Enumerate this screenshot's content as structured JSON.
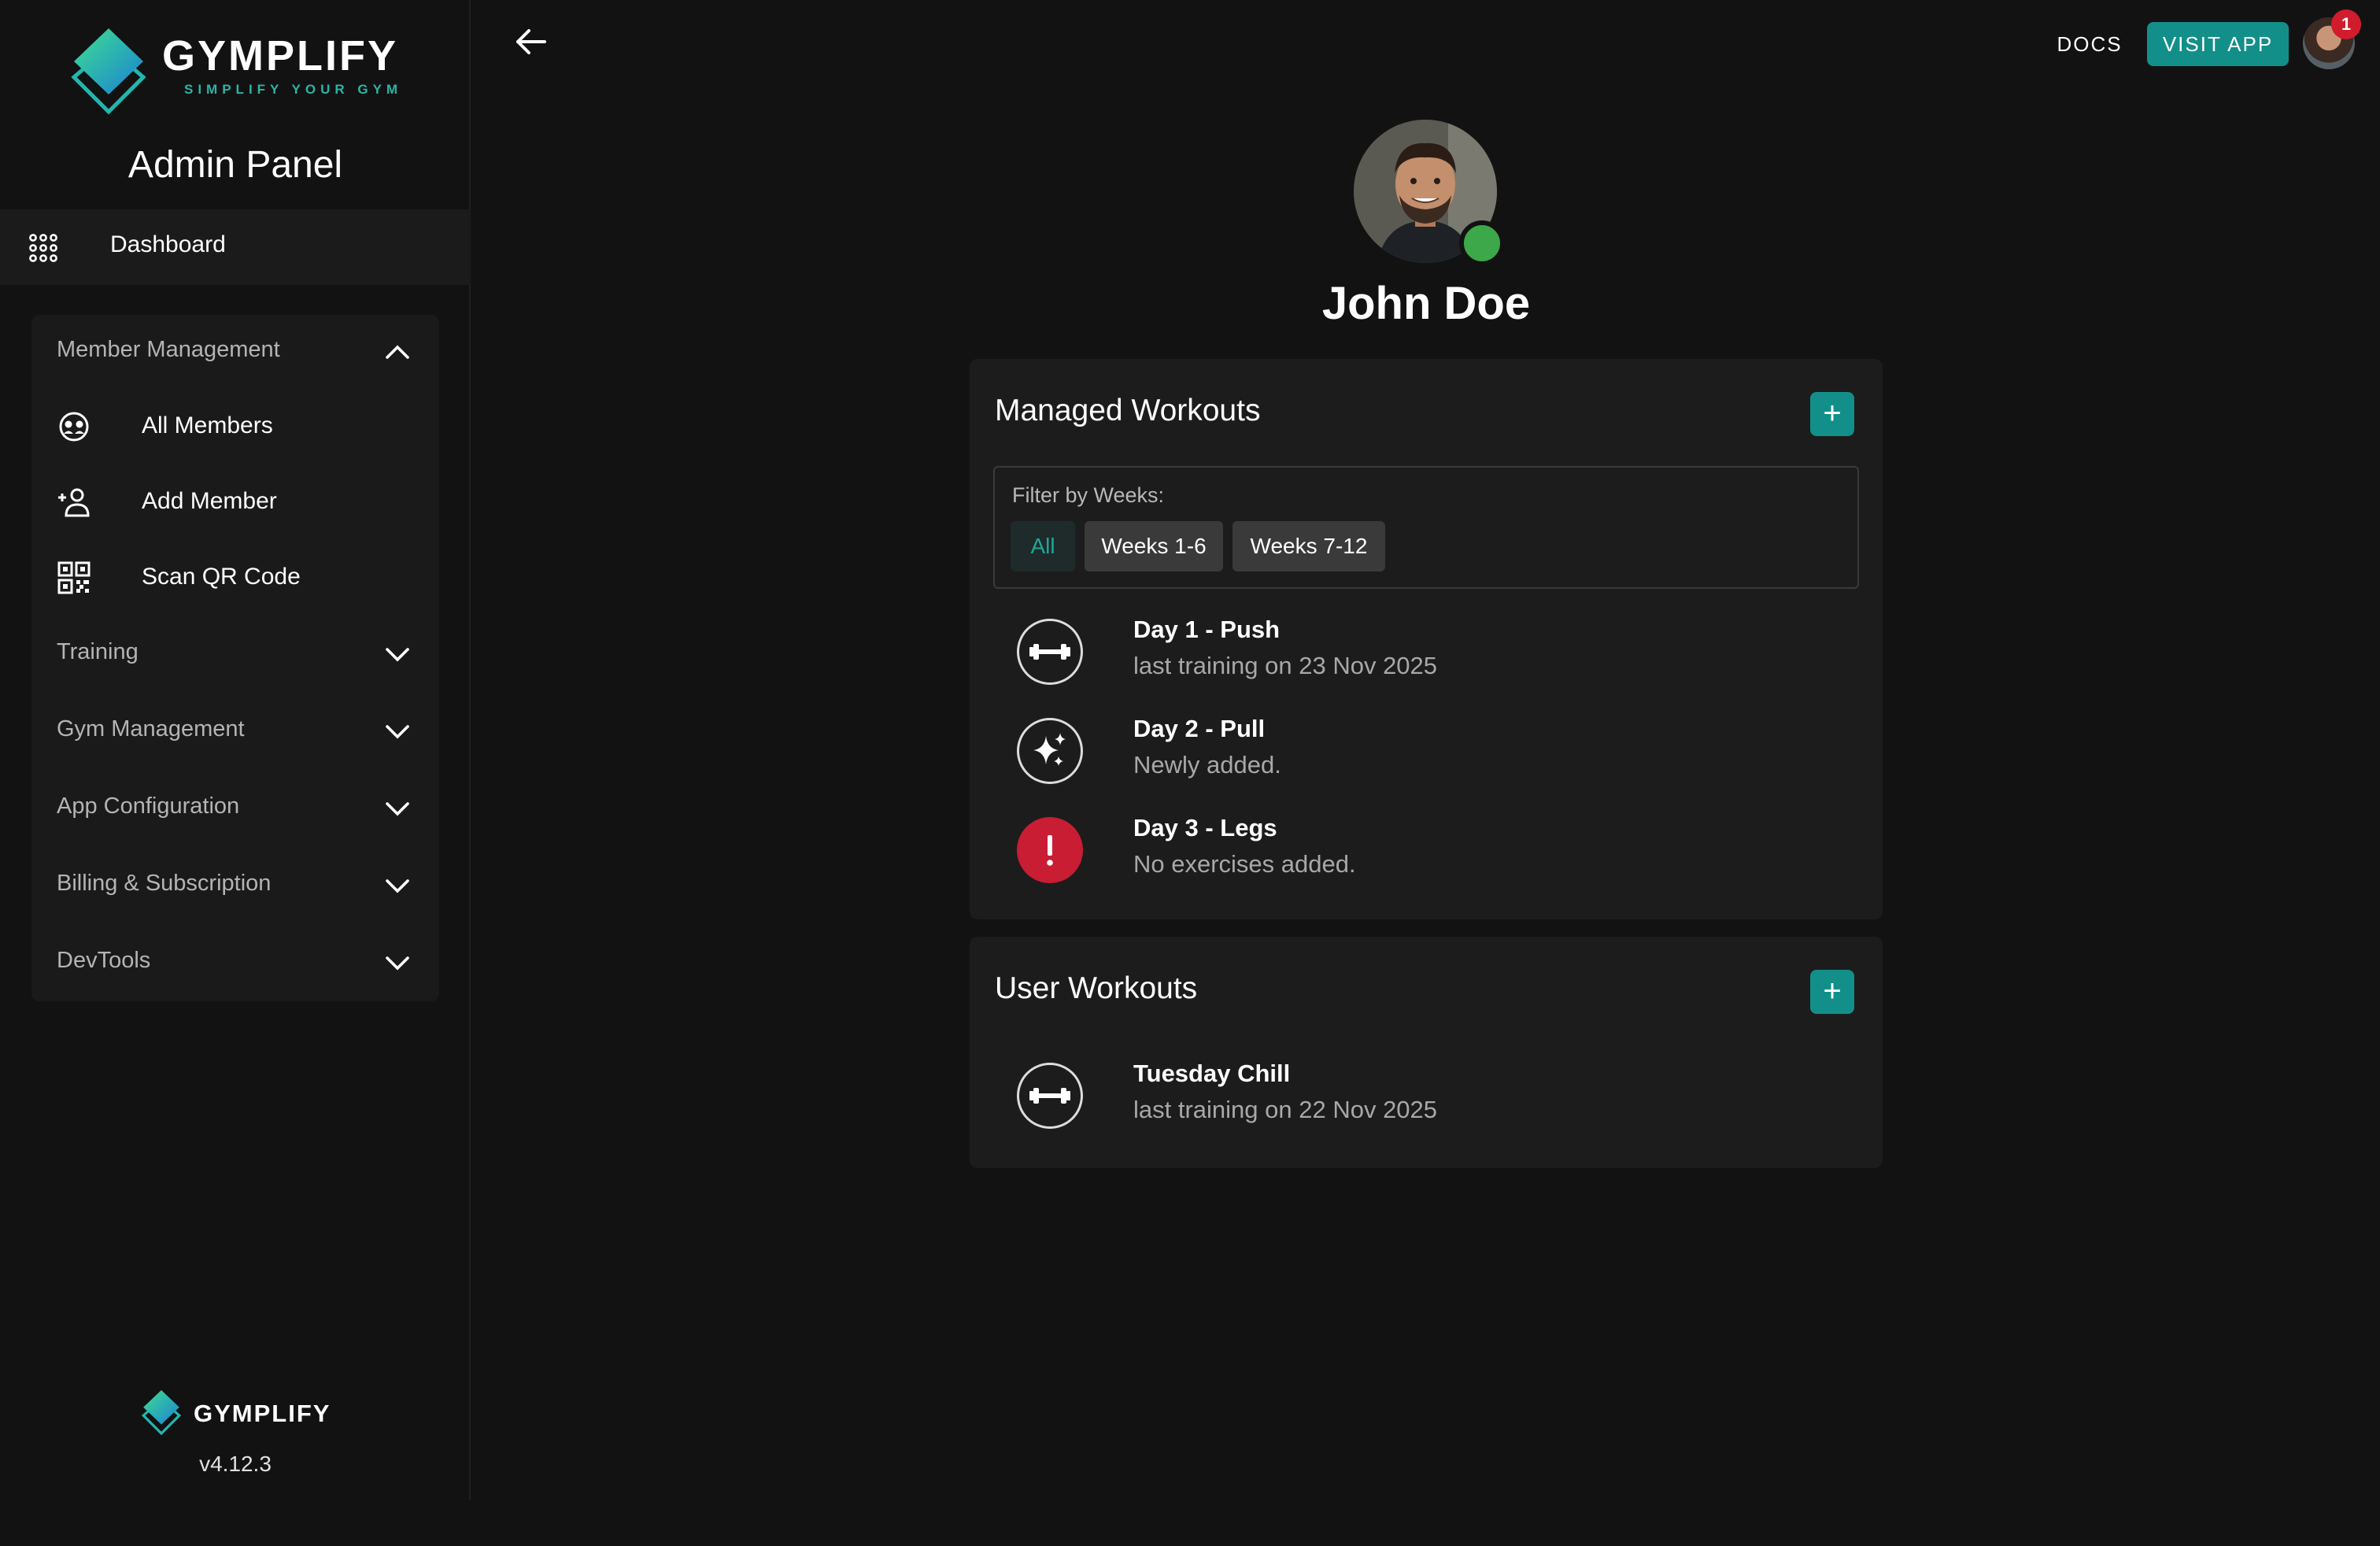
{
  "brand": {
    "name": "GYMPLIFY",
    "tagline": "SIMPLIFY YOUR GYM",
    "panel_title": "Admin Panel",
    "version": "v4.12.3",
    "accent": "#138f8a"
  },
  "sidebar": {
    "dashboard_label": "Dashboard",
    "sections": [
      {
        "label": "Member Management",
        "expanded": true,
        "items": [
          {
            "label": "All Members",
            "icon": "members-icon"
          },
          {
            "label": "Add Member",
            "icon": "add-person-icon"
          },
          {
            "label": "Scan QR Code",
            "icon": "qr-code-icon"
          }
        ]
      },
      {
        "label": "Training",
        "expanded": false
      },
      {
        "label": "Gym Management",
        "expanded": false
      },
      {
        "label": "App Configuration",
        "expanded": false
      },
      {
        "label": "Billing & Subscription",
        "expanded": false
      },
      {
        "label": "DevTools",
        "expanded": false
      }
    ]
  },
  "topbar": {
    "docs_label": "DOCS",
    "visit_app_label": "VISIT APP",
    "notification_count": "1"
  },
  "profile": {
    "name": "John Doe",
    "status": "online",
    "status_color": "#3ca84a"
  },
  "managed_workouts": {
    "title": "Managed Workouts",
    "add_symbol": "+",
    "filter_label": "Filter by Weeks:",
    "filters": [
      "All",
      "Weeks 1-6",
      "Weeks 7-12"
    ],
    "selected_filter": "All",
    "items": [
      {
        "title": "Day 1 - Push",
        "subtitle": "last training on 23 Nov 2025",
        "icon": "dumbbell-icon"
      },
      {
        "title": "Day 2 - Pull",
        "subtitle": "Newly added.",
        "icon": "sparkle-icon"
      },
      {
        "title": "Day 3 - Legs",
        "subtitle": "No exercises added.",
        "icon": "alert-icon",
        "alert_color": "#c81d33"
      }
    ]
  },
  "user_workouts": {
    "title": "User Workouts",
    "add_symbol": "+",
    "items": [
      {
        "title": "Tuesday Chill",
        "subtitle": "last training on 22 Nov 2025",
        "icon": "dumbbell-icon"
      }
    ]
  }
}
